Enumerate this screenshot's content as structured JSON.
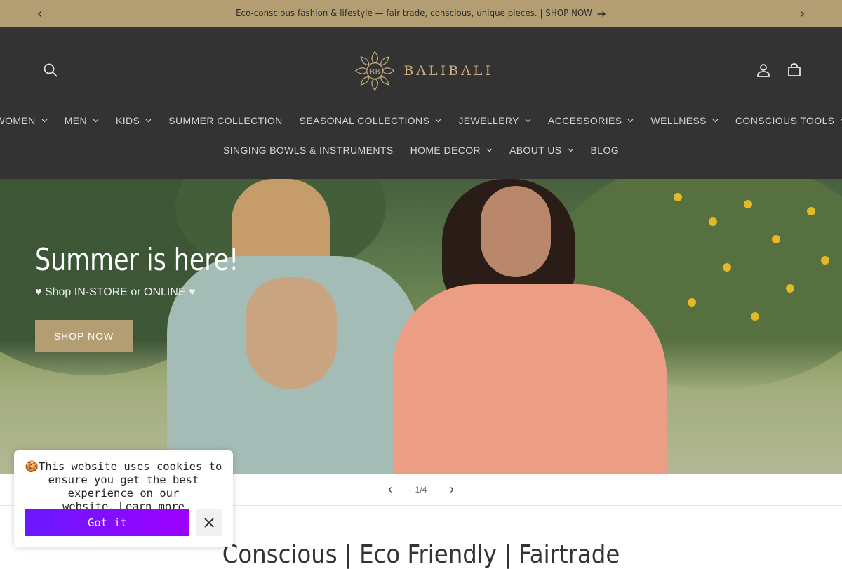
{
  "announcement": {
    "text": "Eco-conscious fashion & lifestyle — fair trade, conscious, unique pieces. | SHOP NOW",
    "prev_icon": "chevron-left-icon",
    "next_icon": "chevron-right-icon"
  },
  "header": {
    "logo_text": "BALIBALI",
    "logo_monogram": "BB",
    "icons": [
      "search-icon",
      "account-icon",
      "cart-icon"
    ]
  },
  "nav": {
    "row1": [
      {
        "label": "WOMEN",
        "dropdown": true
      },
      {
        "label": "MEN",
        "dropdown": true
      },
      {
        "label": "KIDS",
        "dropdown": true
      },
      {
        "label": "SUMMER COLLECTION",
        "dropdown": false
      },
      {
        "label": "SEASONAL COLLECTIONS",
        "dropdown": true
      },
      {
        "label": "JEWELLERY",
        "dropdown": true
      },
      {
        "label": "ACCESSORIES",
        "dropdown": true
      },
      {
        "label": "WELLNESS",
        "dropdown": true
      },
      {
        "label": "CONSCIOUS TOOLS",
        "dropdown": true
      }
    ],
    "row2": [
      {
        "label": "SINGING BOWLS & INSTRUMENTS",
        "dropdown": false
      },
      {
        "label": "HOME DECOR",
        "dropdown": true
      },
      {
        "label": "ABOUT US",
        "dropdown": true
      },
      {
        "label": "BLOG",
        "dropdown": false
      }
    ]
  },
  "hero": {
    "title": "Summer is here!",
    "subtitle": "♥ Shop IN-STORE or ONLINE ♥",
    "button_label": "SHOP NOW"
  },
  "slider": {
    "counter": "1/4"
  },
  "section": {
    "heading_partial": "Conscious | Eco Friendly | Fairtrade"
  },
  "cookie": {
    "message": "🍪This website uses cookies to ensure you get the best experience on our website.",
    "learn_more": "Learn more",
    "accept_label": "Got it"
  },
  "colors": {
    "announcement_bg": "#b39e73",
    "header_bg": "#333333",
    "logo_gold": "#c4ac7c",
    "button_gold": "#b39e73",
    "cookie_button_start": "#6a18ff",
    "cookie_button_end": "#9d00ff"
  }
}
